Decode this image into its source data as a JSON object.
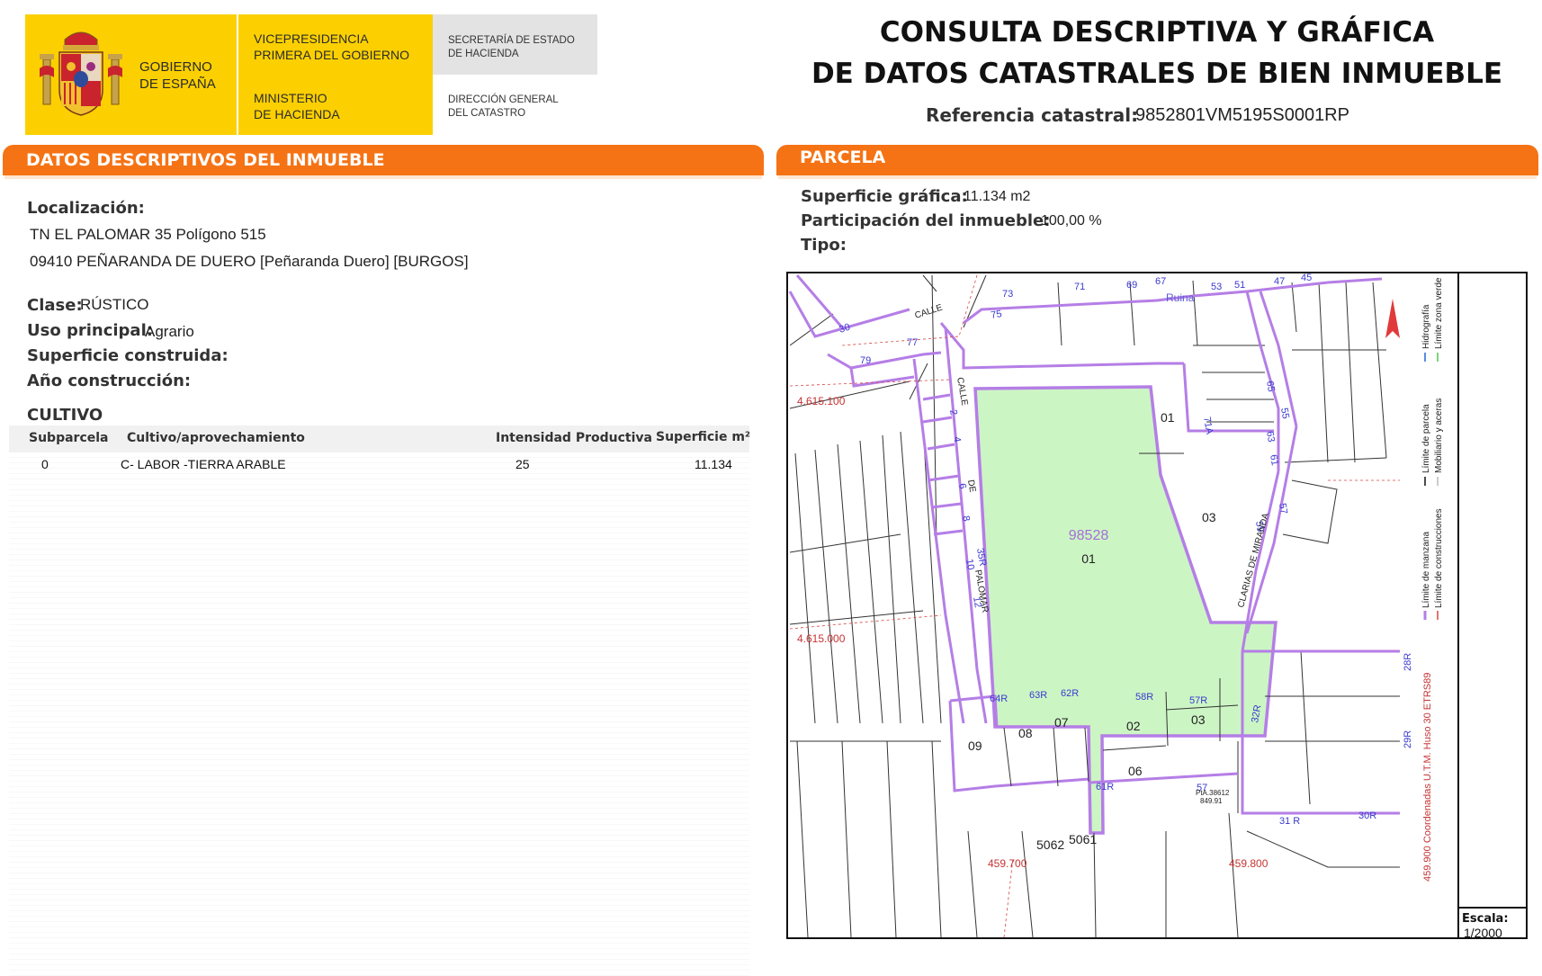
{
  "header": {
    "gov_name": [
      "GOBIERNO",
      "DE ESPAÑA"
    ],
    "vice": [
      "VICEPRESIDENCIA",
      "PRIMERA DEL GOBIERNO"
    ],
    "ministry": [
      "MINISTERIO",
      "DE HACIENDA"
    ],
    "secretaria": [
      "SECRETARÍA DE ESTADO",
      "DE HACIENDA"
    ],
    "direccion": [
      "DIRECCIÓN GENERAL",
      "DEL CATASTRO"
    ],
    "title_line1": "CONSULTA DESCRIPTIVA Y GRÁFICA",
    "title_line2": "DE DATOS CATASTRALES DE BIEN INMUEBLE",
    "ref_label": "Referencia catastral:",
    "ref_value": "9852801VM5195S0001RP"
  },
  "left": {
    "bar_title": "DATOS DESCRIPTIVOS DEL INMUEBLE",
    "localizacion_label": "Localización:",
    "address_line1": "TN EL PALOMAR 35 Polígono 515",
    "address_line2": "09410 PEÑARANDA DE DUERO [Peñaranda Duero] [BURGOS]",
    "clase_label": "Clase:",
    "clase_value": "RÚSTICO",
    "uso_label": "Uso principal:",
    "uso_value": "Agrario",
    "superficie_label": "Superficie construida:",
    "anio_label": "Año construcción:",
    "cultivo_title": "CULTIVO",
    "table": {
      "headers": [
        "Subparcela",
        "Cultivo/aprovechamiento",
        "Intensidad Productiva",
        "Superficie m²"
      ],
      "rows": [
        [
          "0",
          "C- LABOR -TIERRA ARABLE",
          "25",
          "11.134"
        ]
      ]
    }
  },
  "right": {
    "bar_title": "PARCELA",
    "sup_label": "Superficie gráfica:",
    "sup_value": "11.134 m2",
    "part_label": "Participación del inmueble:",
    "part_value": "100,00 %",
    "tipo_label": "Tipo:"
  },
  "map": {
    "parcel_id": "98528",
    "parcel_sub": "01",
    "coord_y1": "4.615.100",
    "coord_y2": "4.615.000",
    "coord_x1": "459.700",
    "coord_x2": "459.800",
    "labels": {
      "n73": "73",
      "n71": "71",
      "n69": "69",
      "n67": "67",
      "ruina": "Ruina",
      "n53": "53",
      "n51": "51",
      "n47": "47",
      "n45": "45",
      "n30": "30",
      "calle1": "CALLE",
      "n75": "75",
      "n79": "79",
      "n77": "77",
      "calle2": "CALLE",
      "n2": "2",
      "n4": "4",
      "de": "DE",
      "n6": "6",
      "n8": "8",
      "n10": "10",
      "n35r": "35R",
      "palomar": "PALOMAR",
      "n12": "12",
      "s01": "01",
      "s71a": "71A",
      "s03": "03",
      "n65": "65",
      "n55": "55",
      "n63": "63",
      "n61": "61",
      "n59": "59",
      "n57": "57",
      "clarias": "CLARIAS DE MIRANDA",
      "n64r": "64R",
      "n63r": "63R",
      "n62r": "62R",
      "n58r": "58R",
      "n57r": "57R",
      "s09": "09",
      "s08": "08",
      "s07": "07",
      "s02": "02",
      "s03b": "03",
      "s06": "06",
      "n61r": "61R",
      "n57b": "57",
      "pto": "PtA.38612",
      "pto2": "849.91",
      "n32r": "32R",
      "n28r": "28R",
      "n29r": "29R",
      "n31r": "31 R",
      "n30r": "30R",
      "p5062": "5062",
      "p5061": "5061"
    },
    "legend": {
      "l1": "Límite de manzana",
      "l2": "Límite de construcciones",
      "l3": "Límite de parcela",
      "l4": "Mobiliario y aceras",
      "l5": "Hidrografía",
      "l6": "Límite zona verde",
      "coords_note": "459.900 Coordenadas U.T.M. Huso 30 ETRS89"
    },
    "scale_label": "Escala:",
    "scale_value": "1/2000"
  },
  "colors": {
    "orange": "#f57314",
    "parcel_fill": "#ccf5c4",
    "parcel_border": "#b57ee6",
    "gov_yellow": "#fcd000"
  }
}
